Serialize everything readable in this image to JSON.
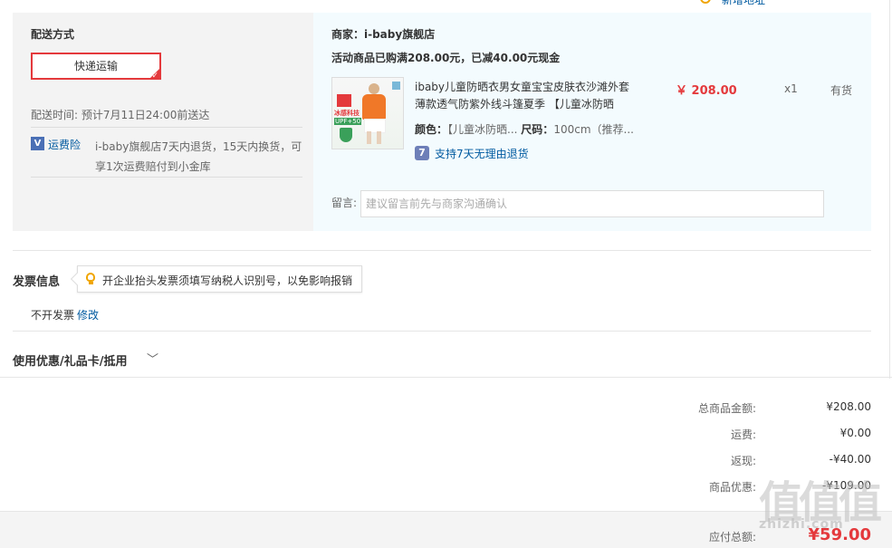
{
  "top": {
    "link_text": "新增地址"
  },
  "shipping": {
    "title": "配送方式",
    "method_button": "快递运输",
    "delivery_time": "配送时间: 预计7月11日24:00前送达",
    "insurance_label": "运费险",
    "insurance_desc_line1": "i-baby旗舰店7天内退货，15天内换货，可",
    "insurance_desc_line2": "享1次运费赔付到小金库"
  },
  "order": {
    "merchant": "商家：i-baby旗舰店",
    "promo": "活动商品已购满208.00元，已减40.00元现金",
    "product": {
      "name_line1": "ibaby儿童防晒衣男女童宝宝皮肤衣沙滩外套",
      "name_line2": "薄款透气防紫外线斗篷夏季 【儿童冰防晒",
      "price": "￥ 208.00",
      "quantity": "x1",
      "stock": "有货",
      "attr_color_label": "颜色：",
      "attr_color_value": "【儿童冰防晒...",
      "attr_size_label": "尺码：",
      "attr_size_value": "100cm（推荐...",
      "return_policy": "支持7天无理由退货",
      "thumb_text_top": "冰感科技",
      "thumb_text_badge": "UPF+50"
    },
    "note_label": "留言:",
    "note_placeholder": "建议留言前先与商家沟通确认"
  },
  "invoice": {
    "title": "发票信息",
    "tip": "开企业抬头发票须填写纳税人识别号，以免影响报销",
    "status": "不开发票",
    "edit": "修改"
  },
  "coupon": {
    "title": "使用优惠/礼品卡/抵用"
  },
  "summary": {
    "rows": [
      {
        "label": "总商品金额:",
        "value": "¥208.00"
      },
      {
        "label": "运费:",
        "value": "¥0.00"
      },
      {
        "label": "返现:",
        "value": "-¥40.00"
      },
      {
        "label": "商品优惠:",
        "value": "-¥109.00"
      }
    ],
    "payable_label": "应付总额:",
    "payable_value": "¥59.00"
  },
  "watermark": {
    "glyphs": "值值值",
    "url": "zhizhi.com"
  },
  "colors": {
    "accent_red": "#e4393c",
    "link_blue": "#005aa0",
    "panel_grey": "#f3f3f3",
    "panel_blue": "#f3fbfe"
  }
}
